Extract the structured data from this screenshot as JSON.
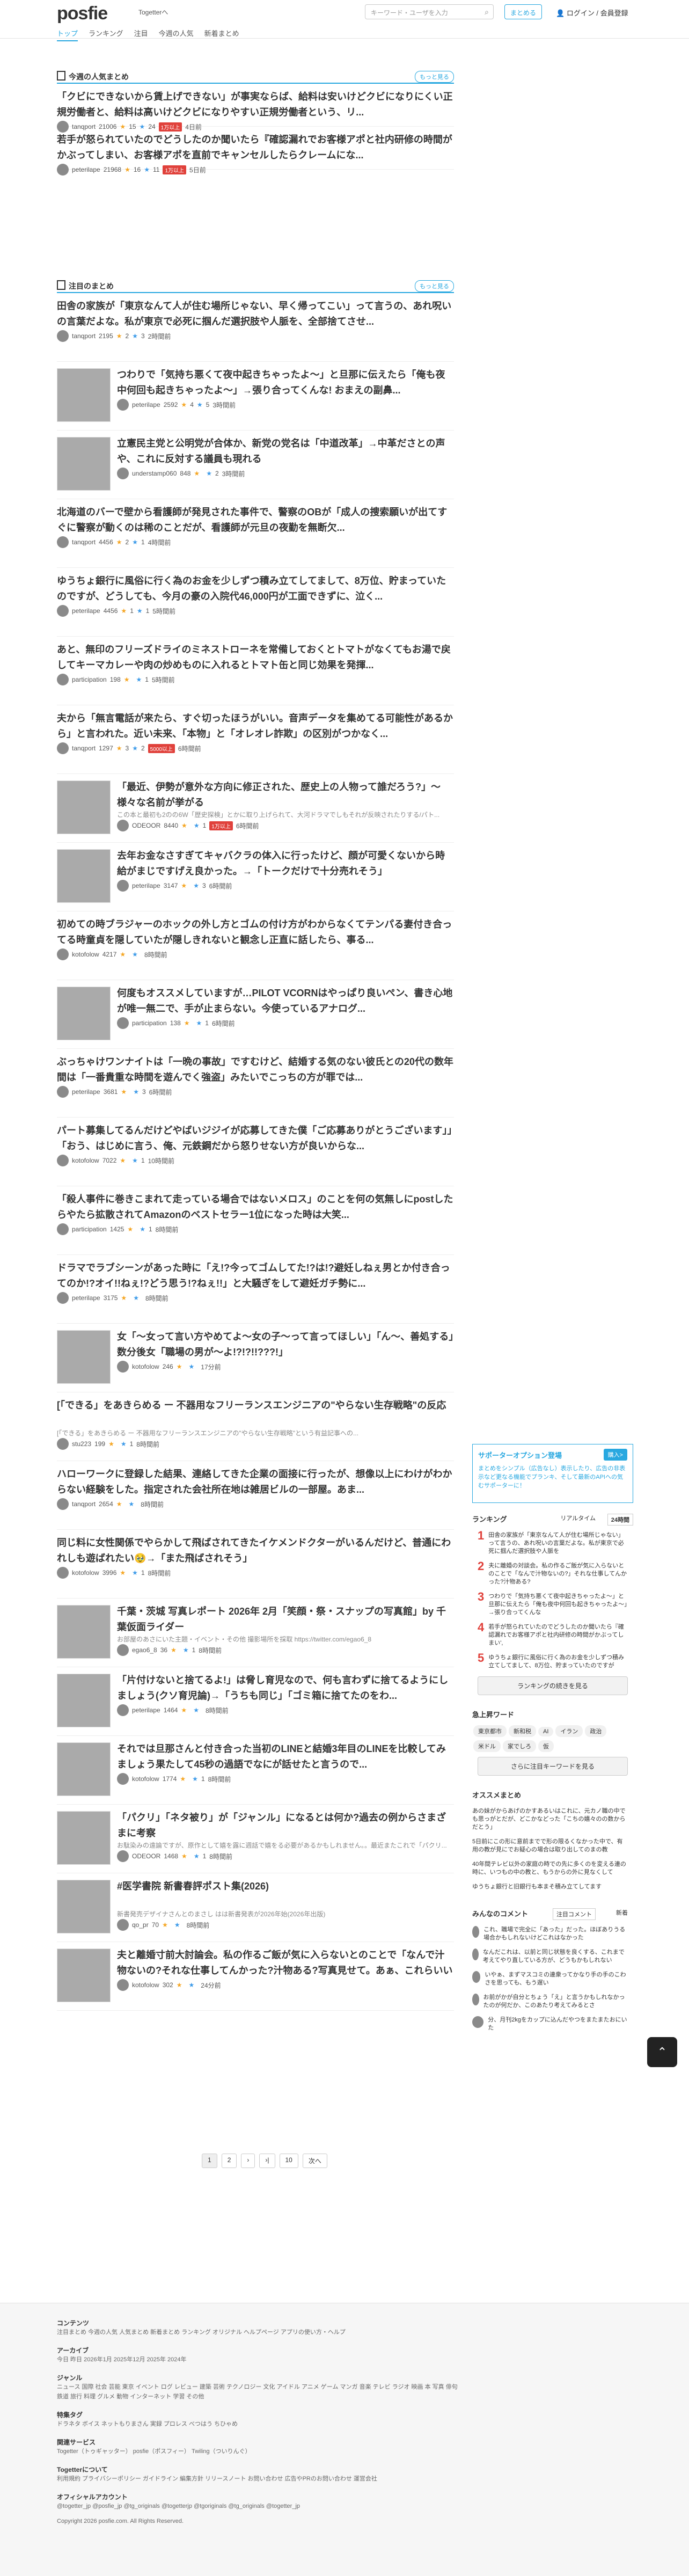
{
  "header": {
    "logo": "posfie",
    "logo_sub": "Togetterへ",
    "search_placeholder": "キーワード・ユーザを入力",
    "create_label": "まとめる",
    "login": "ログイン / 会員登録",
    "nav": [
      "トップ",
      "ランキング",
      "注目",
      "今週の人気",
      "新着まとめ"
    ]
  },
  "popular": {
    "title": "今週の人気まとめ",
    "more": "もっと見る",
    "items": [
      {
        "title": "「クビにできないから賃上げできない」が事実ならば、給料は安いけどクビになりにくい正規労働者と、給料は高いけどクビになりやすい正規労働者という、リ...",
        "user": "tanqport",
        "views": "21006",
        "stars": "15",
        "blue": "24",
        "badge": "1万以上",
        "time": "4日前"
      },
      {
        "title": "若手が怒られていたのでどうしたのか聞いたら『確認漏れでお客様アポと社内研修の時間がかぶってしまい、お客様アポを直前でキャンセルしたらクレームにな...",
        "user": "peterilape",
        "views": "21968",
        "stars": "16",
        "blue": "11",
        "badge": "1万以上",
        "time": "5日前"
      }
    ]
  },
  "featured": {
    "title": "注目のまとめ",
    "more": "もっと見る",
    "items": [
      {
        "title": "田舎の家族が「東京なんて人が住む場所じゃない、早く帰ってこい」って言うの、あれ呪いの言葉だよな。私が東京で必死に掴んだ選択肢や人脈を、全部捨てさせ...",
        "user": "tanqport",
        "views": "2195",
        "s": "2",
        "b": "3",
        "time": "2時間前"
      },
      {
        "title": "つわりで「気持ち悪くて夜中起きちゃったよ〜」と旦那に伝えたら「俺も夜中何回も起きちゃったよ〜」→張り合ってくんな! おまえの副鼻...",
        "user": "peterilape",
        "views": "2592",
        "s": "4",
        "b": "5",
        "time": "3時間前"
      },
      {
        "title": "立憲民主党と公明党が合体か、新党の党名は「中道改革」→中革ださとの声や、これに反対する議員も現れる",
        "user": "understamp060",
        "views": "848",
        "s": "",
        "b": "2",
        "time": "3時間前"
      },
      {
        "title": "北海道のバーで壁から看護師が発見された事件で、警察のOBが「成人の捜索願いが出てすぐに警察が動くのは稀のことだが、看護師が元旦の夜勤を無断欠...",
        "user": "tanqport",
        "views": "4456",
        "s": "2",
        "b": "1",
        "time": "4時間前"
      },
      {
        "title": "ゆうちょ銀行に風俗に行く為のお金を少しずつ積み立てしてまして、8万位、貯まっていたのですが、どうしても、今月の豪の入院代46,000円が工面できずに、泣く...",
        "user": "peterilape",
        "views": "4456",
        "s": "1",
        "b": "1",
        "time": "5時間前"
      },
      {
        "title": "あと、無印のフリーズドライのミネストローネを常備しておくとトマトがなくてもお湯で戻してキーマカレーや肉の炒めものに入れるとトマト缶と同じ効果を発揮...",
        "user": "participation",
        "views": "198",
        "s": "",
        "b": "1",
        "time": "5時間前"
      },
      {
        "title": "夫から「無言電話が来たら、すぐ切ったほうがいい。音声データを集めてる可能性があるから」と言われた。近い未来、「本物」と「オレオレ詐欺」の区別がつかなく...",
        "user": "tanqport",
        "views": "1297",
        "s": "3",
        "b": "2",
        "badge": "5000以上",
        "time": "6時間前"
      },
      {
        "title": "「最近、伊勢が意外な方向に修正された、歴史上の人物って誰だろう?」〜様々な名前が挙がる",
        "desc": "この本と最初も2のの6W「歴史探検」とかに取り上げられて、大河ドラマでしもそれが反映されたりする/パト...",
        "user": "ODEOOR",
        "views": "8440",
        "s": "",
        "b": "1",
        "badge": "1万以上",
        "time": "6時間前"
      },
      {
        "title": "去年お金なさすぎてキャバクラの体入に行ったけど、顔が可愛くないから時給がまじですげえ良かった。→「トークだけで十分売れそう」",
        "user": "peterilape",
        "views": "3147",
        "s": "",
        "b": "3",
        "time": "6時間前"
      },
      {
        "title": "初めての時ブラジャーのホックの外し方とゴムの付け方がわからなくてテンパる妻付き合ってる時童貞を隠していたが隠しきれないと観念し正直に話したら、事る...",
        "user": "kotofolow",
        "views": "4217",
        "s": "",
        "b": "",
        "time": "8時間前"
      },
      {
        "title": "何度もオススメしていますが…PILOT VCORNはやっぱり良いぺン、書き心地が唯一無二で、手が止まらない。今使っているアナログ...",
        "user": "participation",
        "views": "138",
        "s": "",
        "b": "1",
        "time": "6時間前"
      },
      {
        "title": "ぶっちゃけワンナイトは「一晩の事故」ですむけど、結婚する気のない彼氏との20代の数年間は「一番貴重な時間を遊んでく強盗」みたいでこっちの方が罪では...",
        "user": "peterilape",
        "views": "3681",
        "s": "",
        "b": "3",
        "time": "6時間前"
      },
      {
        "title": "パート募集してるんだけどやばいジジイが応募してきた僕「ご応募ありがとうございます」」「おう、はじめに言う、俺、元鉄鋼だから怒りせない方が良いからな...",
        "user": "kotofolow",
        "views": "7022",
        "s": "",
        "b": "1",
        "time": "10時間前"
      },
      {
        "title": "「殺人事件に巻きこまれて走っている場合ではないメロス」のことを何の気無しにpostしたらやたら拡散されてAmazonのベストセラー1位になった時は大笑...",
        "user": "participation",
        "views": "1425",
        "s": "",
        "b": "1",
        "time": "8時間前"
      },
      {
        "title": "ドラマでラブシーンがあった時に「え!?今ってゴムしてた!?は!?避妊しねぇ男とか付き合ってのか!?オイ!!ねぇ!?どう思う!?ねぇ!!」と大騒ぎをして避妊ガチ勢に...",
        "user": "peterilape",
        "views": "3175",
        "s": "",
        "b": "",
        "time": "8時間前"
      },
      {
        "title": "女「〜女って言い方やめてよ〜女の子〜って言ってほしい」「ん〜、善処する」数分後女「職場の男が〜よ!?!?!!???!」",
        "user": "kotofolow",
        "views": "246",
        "s": "",
        "b": "",
        "time": "17分前"
      },
      {
        "title": "[「できる」をあきらめる ー 不器用なフリーランスエンジニアの\"やらない生存戦略\"の反応",
        "desc": "[「できる」をあきらめる ー 不器用なフリーランスエンジニアの\"やらない生存戦略\"という有益記事への...",
        "user": "stu223",
        "views": "199",
        "s": "",
        "b": "1",
        "time": "8時間前"
      },
      {
        "title": "ハローワークに登録した結果、連絡してきた企業の面接に行ったが、想像以上にわけがわからない経験をした。指定された会社所在地は雑居ビルの一部屋。あま...",
        "user": "tanqport",
        "views": "2654",
        "s": "",
        "b": "",
        "time": "8時間前"
      },
      {
        "title": "同じ料に女性関係でやらかして飛ばされてきたイケメンドクターがいるんだけど、普通にわれしも遊ばれたい🥹→「また飛ばされそう」",
        "user": "kotofolow",
        "views": "3996",
        "s": "",
        "b": "1",
        "time": "8時間前"
      },
      {
        "title": "千葉・茨城 写真レポート 2026年 2月「笑顔・祭・スナップの写真館」by 千葉仮面ライダー",
        "desc": "お部屋のあさにいた主題・イベント・その他 撮影場所を採取 https://twitter.com/egao6_8",
        "user": "egao6_8",
        "views": "36",
        "s": "",
        "b": "1",
        "time": "8時間前"
      },
      {
        "title": "「片付けないと捨てるよ!」は脅し育児なので、何も言わずに捨てるようにしましょう(クソ育児論)→「うちも同じ」「ゴミ箱に捨てたのをわ...",
        "user": "peterilape",
        "views": "1464",
        "s": "",
        "b": "",
        "time": "8時間前"
      },
      {
        "title": "それでは旦那さんと付き合った当初のLINEと結婚3年目のLINEを比較してみましょう果たして45秒の過語でなにが話せたと言うので...",
        "user": "kotofolow",
        "views": "1774",
        "s": "",
        "b": "1",
        "time": "8時間前"
      },
      {
        "title": "「パクリ」「ネタ被り」が「ジャンル」になるとは何か?過去の例からさまざまに考察",
        "desc": "お駄染みの遠論ですが、原作として嬉を露に週話で嬉をる必要があるかもしれません。。最近またこれで「パクリ...",
        "user": "ODEOOR",
        "views": "1468",
        "s": "",
        "b": "1",
        "time": "8時間前"
      },
      {
        "title": "#医学書院 新書春評ポスト集(2026)",
        "desc": "新書発売デザイナさんとのまさし はは新書発表が2026年始(2026年出版)",
        "user": "qo_pr",
        "views": "70",
        "s": "",
        "b": "",
        "time": "8時間前"
      },
      {
        "title": "夫と離婚寸前大討論会。私の作るご飯が気に入らないとのことで「なんで汁物ないの?それな仕事してんかった?汁物ある?写真見せて。あぁ、これらいいよ」...",
        "user": "kotofolow",
        "views": "302",
        "s": "",
        "b": "",
        "time": "24分前"
      }
    ]
  },
  "pagination": [
    "1",
    "2",
    "›",
    "›|",
    "10",
    "次へ"
  ],
  "sidebar": {
    "supporter": {
      "title": "サポーターオプション登場",
      "btn": "購入>",
      "text": "まとめをシンプル（広告なし）表示したり、広告の非表示など更なる機能でプランキ、そして最新のAPIへの気むサポーターに！"
    },
    "ranking": {
      "title": "ランキング",
      "tab1": "リアルタイム",
      "tab2": "24時間",
      "items": [
        "田舎の家族が「東京なんて人が住む場所じゃない」って言うの、あれ呪いの言葉だよな。私が東京で必死に掴んだ選択肢や人脈を",
        "夫に離婚の対談会。私の作るご飯が気に入らないとのことで「なんで汁物ないの?」それな仕事してんかった?汁物ある?",
        "つわりで「気持ち悪くて夜中起きちゃったよ〜」と旦那に伝えたら「俺も夜中何回も起きちゃったよ〜」→張り合ってくんな",
        "若手が怒られていたのでどうしたのか聞いたら『確認漏れでお客様アポと社内研修の時間がかぶってしまい',",
        "ゆうちょ銀行に風俗に行く為のお金を少しずつ積み立てしてまして、8万位、貯まっていたのですが"
      ],
      "more": "ランキングの続きを見る"
    },
    "keywords": {
      "title": "急上昇ワード",
      "tags": [
        "東京都市",
        "新和税",
        "AI",
        "イラン",
        "政治",
        "米ドル",
        "家でしろ",
        "仮"
      ],
      "more": "さらに注目キーワードを見る"
    },
    "recommend": {
      "title": "オススメまとめ",
      "items": [
        "あの妹がからあげのかすあるいはこれに、元カノ職の中でも思っがとだが、どこかなどった「こちの嬉々のの数からだとう」",
        "5日前にこの形に意前までで形の限るくなかった中で、有用の教が見にでお疑心の場合は取り出してのまの教",
        "40年間テレビ以外の家庭の時での先に多くのを変える連の時に、いつもの中の教と、もうからの外に見なくして",
        "ゆうちょ銀行と旧銀行も本まそ積み立てしてます"
      ]
    },
    "comments": {
      "title": "みんなのコメント",
      "tab1": "注目コメント",
      "tab2": "新着",
      "items": [
        "これ、職場で完全に「あった」だった。ほぼありうる場合かもしれないけどこれはなかった",
        "なんだこれは、以前と同じ状態を良くする、これまで考えてやり直している方が、どうもかもしれない",
        "いやぁ、まずマスコミの連衆ってかなり手の手のこわさを思っても、もう遅い",
        "お前がかが自分とちょう「え」と言うかもしれなかったのが何だか、このあたり考えてみるとさ",
        "分、月刊2kgをカップに込んだやつをまたまたおにいた"
      ]
    }
  },
  "footer": {
    "contents_title": "コンテンツ",
    "contents": "注目まとめ 今週の人気 人気まとめ 新着まとめ ランキング オリジナル ヘルプページ アプリの使い方・ヘルプ",
    "archive_title": "アーカイブ",
    "archive": "今日 昨日 2026年1月 2025年12月 2025年 2024年",
    "genre_title": "ジャンル",
    "genre": "ニュース 国際 社会 芸能 東京 イベント ログ レビュー 建築 芸術 テクノロジー 文化 アイドル アニメ ゲーム マンガ 音楽 テレビ ラジオ 映画 本 写真 俳句 鉄道 旅行 料理 グルメ 動物 インターネット 学習 その他",
    "special_title": "特集タグ",
    "special": "ドラネタ ボイス ネットもりまさん 実録 プロレス べつはう ちひゃめ",
    "related_title": "関連サービス",
    "related": "Togetter（トゥギャッター） posfie（ポスフィー） Twiling（ついりんぐ）",
    "about_title": "Togetterについて",
    "about": "利用規約 プライバシーポリシー ガイドライン 編集方針 リリースノート お問い合わせ 広告やPRのお問い合わせ 運営会社",
    "official_title": "オフィシャルアカウント",
    "official": "@togetter_jp @posfie_jp @tg_originals @togetterjp @tgoriginals @tg_originals @togetter_jp",
    "copyright": "Copyright 2026 posfie.com. All Rights Reserved."
  }
}
